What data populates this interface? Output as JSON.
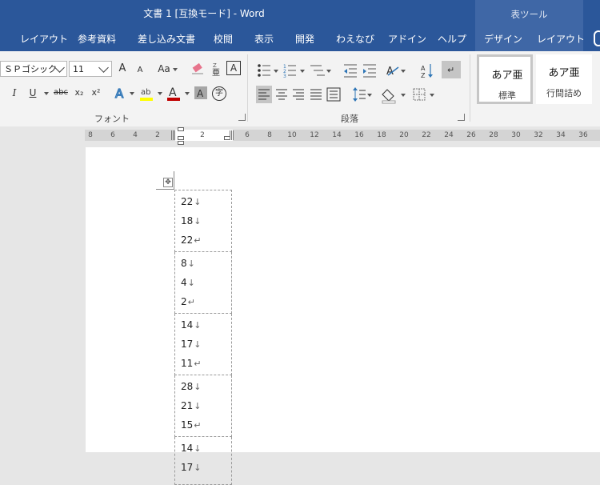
{
  "window": {
    "title": "文書 1 [互換モード] - Word"
  },
  "context_tab_group": {
    "label": "表ツール"
  },
  "tabs": [
    {
      "label": "レイアウト"
    },
    {
      "label": "参考資料"
    },
    {
      "label": "差し込み文書"
    },
    {
      "label": "校閲"
    },
    {
      "label": "表示"
    },
    {
      "label": "開発"
    },
    {
      "label": "わえなび"
    },
    {
      "label": "アドイン"
    },
    {
      "label": "ヘルプ"
    },
    {
      "label": "デザイン"
    },
    {
      "label": "レイアウト"
    }
  ],
  "font_group": {
    "label": "フォント",
    "font_name": "ＳＰゴシック",
    "font_size": "11",
    "grow_label": "A",
    "shrink_label": "A",
    "change_case_label": "Aa",
    "italic_label": "I",
    "underline_label": "U",
    "strike_label": "abc",
    "subscript_label": "x₂",
    "superscript_label": "x²",
    "char_border_label": "A",
    "enclose_label": "字",
    "font_color": "#c00000",
    "highlight_color": "#ffff00"
  },
  "paragraph_group": {
    "label": "段落"
  },
  "styles": [
    {
      "sample": "あア亜",
      "name": "標準"
    },
    {
      "sample": "あア亜",
      "name": "行間詰め"
    }
  ],
  "ruler": {
    "left_ticks": [
      "8",
      "6",
      "4",
      "2"
    ],
    "center_tick": "2",
    "right_ticks": [
      "6",
      "8",
      "10",
      "12",
      "14",
      "16",
      "18",
      "20",
      "22",
      "24",
      "26",
      "28",
      "30",
      "32",
      "34",
      "36"
    ]
  },
  "table": {
    "rows": [
      [
        "22",
        "18",
        "22"
      ],
      [
        "8",
        "4",
        "2"
      ],
      [
        "14",
        "17",
        "11"
      ],
      [
        "28",
        "21",
        "15"
      ],
      [
        "14",
        "17"
      ]
    ],
    "line_break_mark": "↓",
    "paragraph_mark": "↵"
  }
}
